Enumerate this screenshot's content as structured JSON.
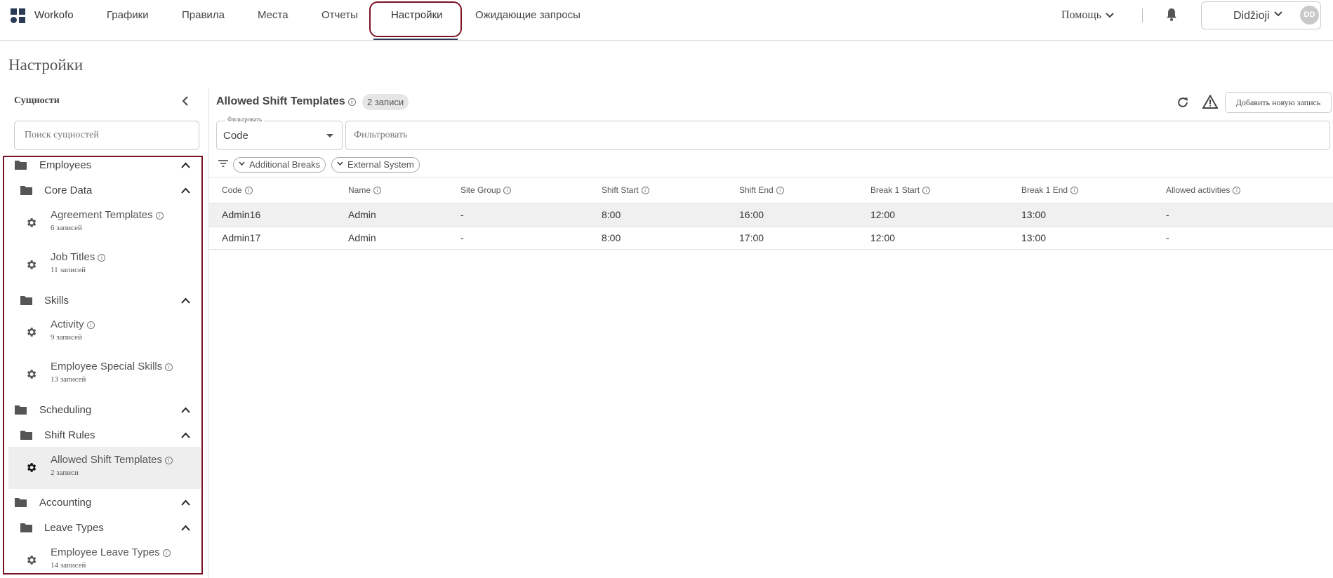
{
  "nav": {
    "brand": "Workofo",
    "items": [
      "Графики",
      "Правила",
      "Места",
      "Отчеты",
      "Настройки",
      "Ожидающие запросы"
    ],
    "help": "Помощь",
    "user_name": "Didžioji",
    "user_initials": "DD"
  },
  "page": {
    "title": "Настройки"
  },
  "sidebar": {
    "heading": "Сущности",
    "search_placeholder": "Поиск сущностей",
    "groups": [
      {
        "label": "Employees"
      },
      {
        "label": "Core Data"
      },
      {
        "label": "Skills"
      },
      {
        "label": "Scheduling"
      },
      {
        "label": "Shift Rules"
      },
      {
        "label": "Accounting"
      },
      {
        "label": "Leave Types"
      }
    ],
    "entities": [
      {
        "name": "Agreement Templates",
        "count": "6 записей"
      },
      {
        "name": "Job Titles",
        "count": "11 записей"
      },
      {
        "name": "Activity",
        "count": "9 записей"
      },
      {
        "name": "Employee Special Skills",
        "count": "13 записей"
      },
      {
        "name": "Allowed Shift Templates",
        "count": "2 записи"
      },
      {
        "name": "Employee Leave Types",
        "count": "14 записей"
      }
    ]
  },
  "main": {
    "title": "Allowed Shift Templates",
    "count": "2 записи",
    "add_button": "Добавить новую запись",
    "filter_label": "Фильтровать",
    "filter_field": "Code",
    "filter_value": "Фильтровать",
    "chips": [
      "Additional Breaks",
      "External System"
    ],
    "columns": [
      "Code",
      "Name",
      "Site Group",
      "Shift Start",
      "Shift End",
      "Break 1 Start",
      "Break 1 End",
      "Allowed activities"
    ],
    "rows": [
      [
        "Admin16",
        "Admin",
        "-",
        "8:00",
        "16:00",
        "12:00",
        "13:00",
        "-"
      ],
      [
        "Admin17",
        "Admin",
        "-",
        "8:00",
        "17:00",
        "12:00",
        "13:00",
        "-"
      ]
    ]
  }
}
